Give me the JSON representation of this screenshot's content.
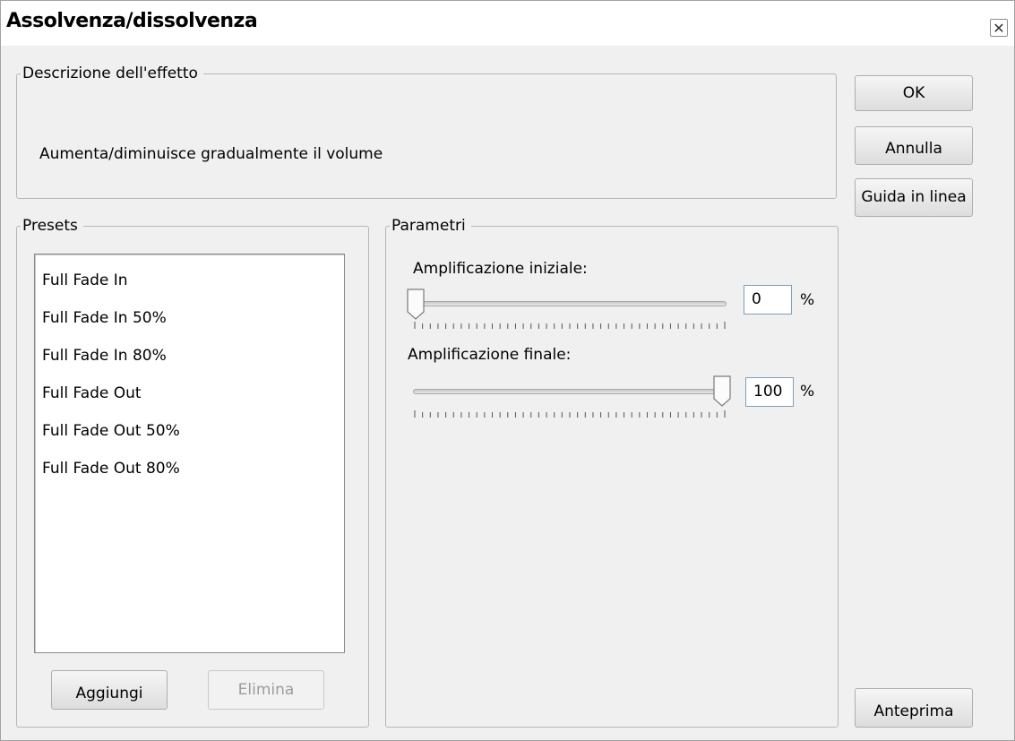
{
  "window": {
    "title": "Assolvenza/dissolvenza",
    "close_glyph": "✕"
  },
  "description": {
    "legend": "Descrizione dell'effetto",
    "text": "Aumenta/diminuisce gradualmente il volume"
  },
  "presets": {
    "legend": "Presets",
    "items": [
      "Full Fade In",
      "Full Fade In 50%",
      "Full Fade In 80%",
      "Full Fade Out",
      "Full Fade Out 50%",
      "Full Fade Out 80%"
    ],
    "add_label": "Aggiungi",
    "delete_label": "Elimina"
  },
  "parameters": {
    "legend": "Parametri",
    "initial": {
      "label": "Amplificazione iniziale:",
      "value": "0",
      "unit": "%",
      "level": 0
    },
    "final": {
      "label": "Amplificazione finale:",
      "value": "100",
      "unit": "%",
      "level": 1
    }
  },
  "buttons": {
    "ok": "OK",
    "cancel": "Annulla",
    "help": "Guida in linea",
    "preview": "Anteprima"
  }
}
